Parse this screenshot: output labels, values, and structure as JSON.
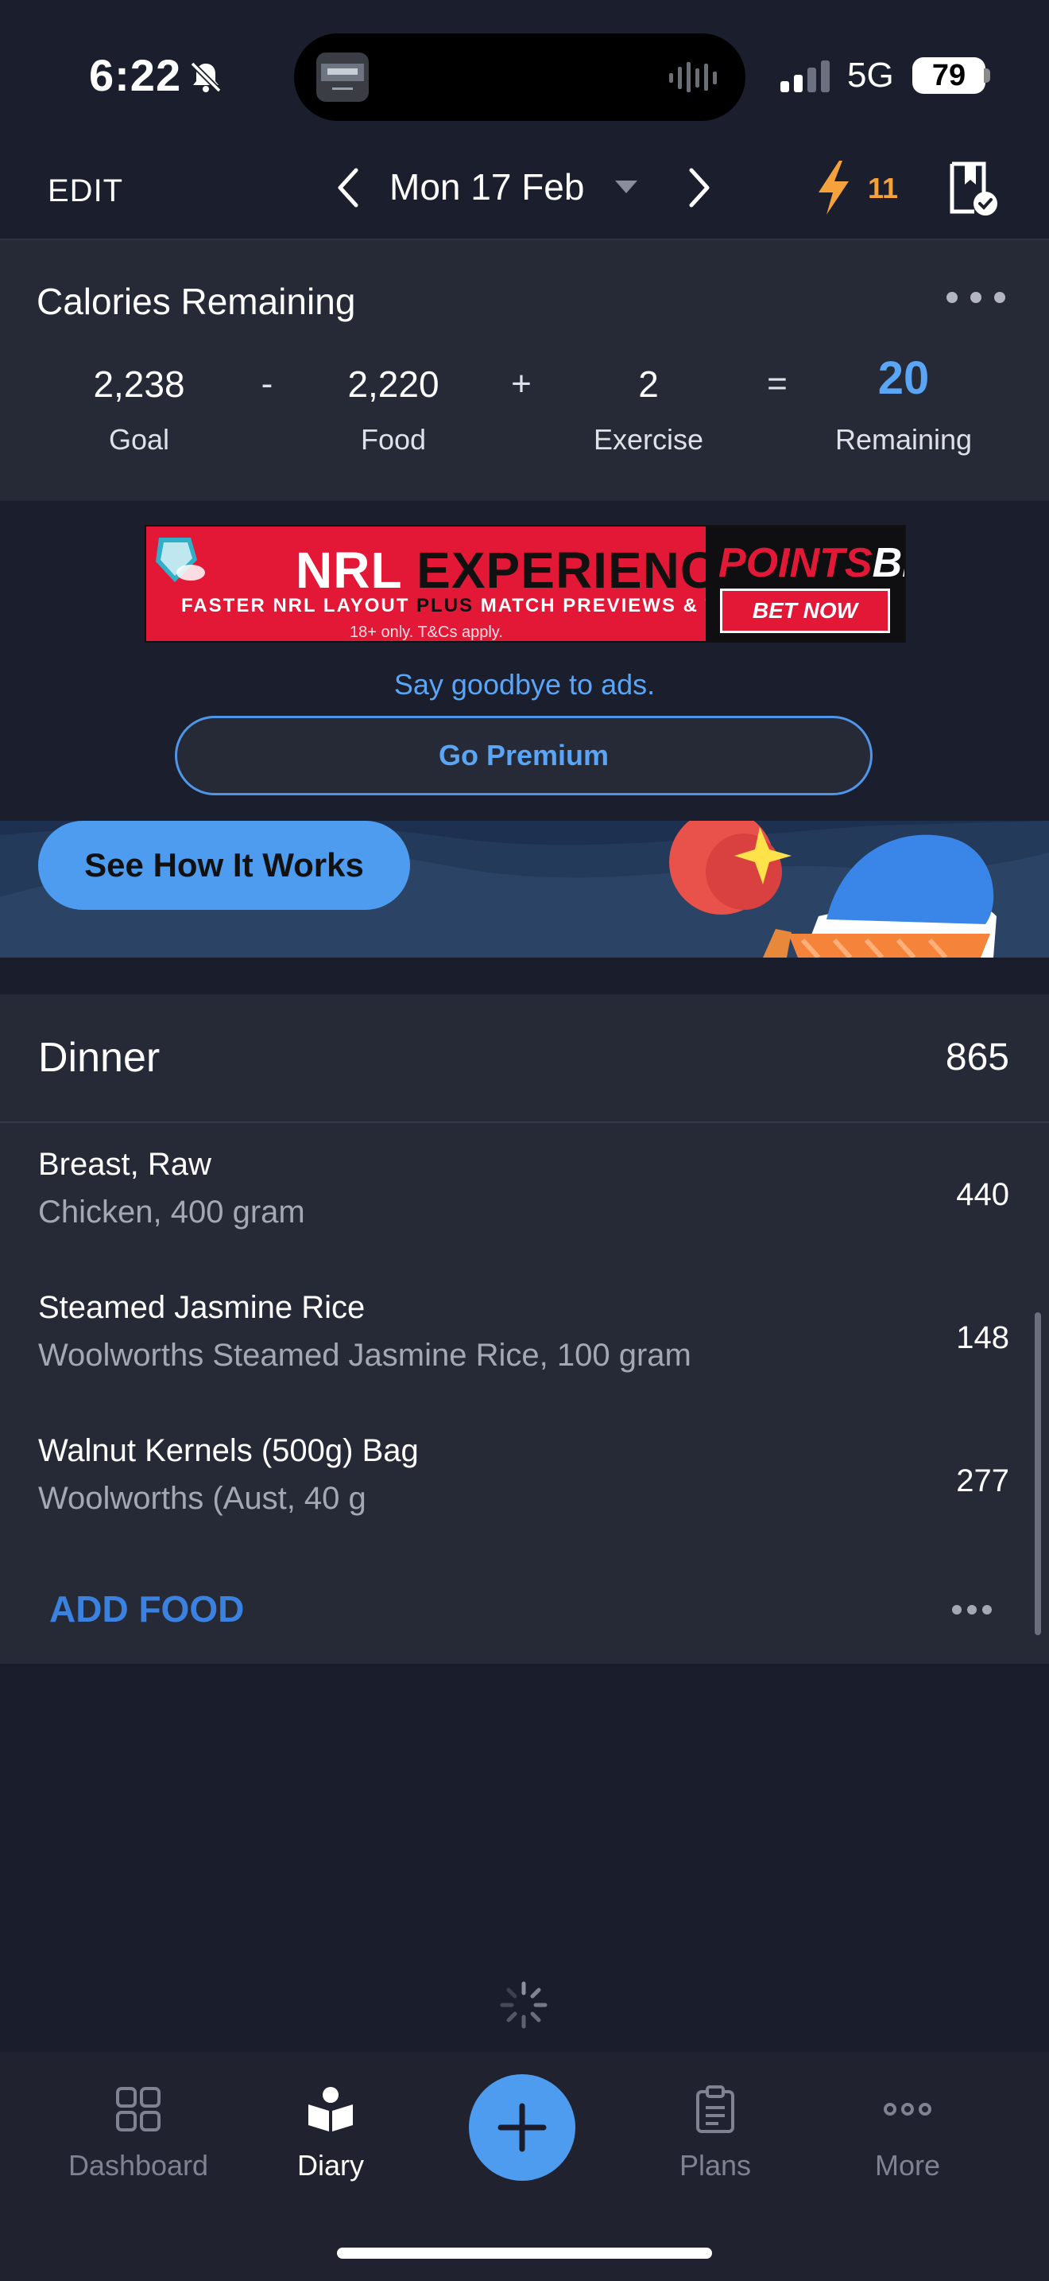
{
  "status_bar": {
    "time": "6:22",
    "network": "5G",
    "battery": "79"
  },
  "top_nav": {
    "edit_label": "EDIT",
    "date": "Mon 17 Feb",
    "streak_count": "11"
  },
  "calories": {
    "title": "Calories Remaining",
    "goal_value": "2,238",
    "goal_label": "Goal",
    "op_minus": "-",
    "food_value": "2,220",
    "food_label": "Food",
    "op_plus": "+",
    "exercise_value": "2",
    "exercise_label": "Exercise",
    "op_equals": "=",
    "remaining_value": "20",
    "remaining_label": "Remaining"
  },
  "ad": {
    "title_part1": "NRL",
    "title_part2": "EXPERIENCE",
    "subtitle_part1": "FASTER NRL LAYOUT",
    "subtitle_plus": "PLUS",
    "subtitle_part2": "MATCH PREVIEWS & TIPS",
    "legal": "18+ only. T&Cs apply.",
    "brand_part1": "POINTS",
    "brand_part2": "BET",
    "cta": "BET NOW",
    "goodbye": "Say goodbye to ads.",
    "premium_button": "Go Premium"
  },
  "promo": {
    "button": "See How It Works"
  },
  "meal": {
    "title": "Dinner",
    "total": "865",
    "items": [
      {
        "name": "Breast, Raw",
        "detail": "Chicken, 400 gram",
        "calories": "440"
      },
      {
        "name": "Steamed Jasmine Rice",
        "detail": "Woolworths Steamed Jasmine Rice, 100 gram",
        "calories": "148"
      },
      {
        "name": "Walnut Kernels (500g) Bag",
        "detail": "Woolworths (Aust, 40 g",
        "calories": "277"
      }
    ],
    "add_food": "ADD FOOD"
  },
  "tabbar": {
    "tabs": [
      {
        "label": "Dashboard",
        "icon": "grid-icon",
        "active": false
      },
      {
        "label": "Diary",
        "icon": "book-icon",
        "active": true
      },
      {
        "label": "Plans",
        "icon": "clipboard-icon",
        "active": false
      },
      {
        "label": "More",
        "icon": "ellipsis-icon",
        "active": false
      }
    ]
  },
  "colors": {
    "accent_blue": "#5aa5f5",
    "link_blue": "#3b82e0",
    "streak_orange": "#f6a23c",
    "card_bg": "#262a37",
    "page_bg": "#1a1d2c"
  }
}
